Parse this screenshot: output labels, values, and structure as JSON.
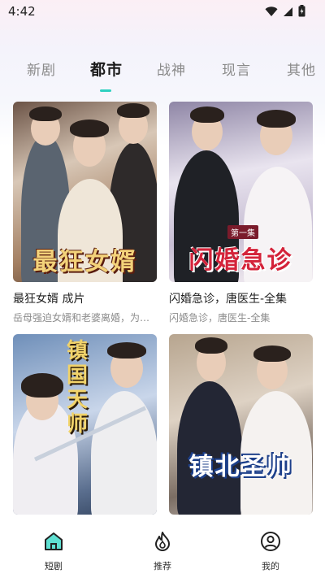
{
  "status_bar": {
    "time": "4:42"
  },
  "tabs": [
    {
      "label": "新剧",
      "active": false
    },
    {
      "label": "都市",
      "active": true
    },
    {
      "label": "战神",
      "active": false
    },
    {
      "label": "现言",
      "active": false
    },
    {
      "label": "其他",
      "active": false
    }
  ],
  "cards": [
    {
      "title": "最狂女婿 成片",
      "description": "岳母强迫女婿和老婆离婚，为了钱……",
      "poster_text": "最狂女婿"
    },
    {
      "title": "闪婚急诊，唐医生-全集",
      "description": "闪婚急诊，唐医生-全集",
      "poster_text": "闪婚急诊",
      "poster_badge": "第一集"
    },
    {
      "title": "",
      "description": "",
      "poster_text": "镇国天师"
    },
    {
      "title": "",
      "description": "",
      "poster_text": "镇北圣帅"
    }
  ],
  "bottom_nav": [
    {
      "label": "短剧",
      "icon": "home-icon",
      "active": true
    },
    {
      "label": "推荐",
      "icon": "flame-icon",
      "active": false
    },
    {
      "label": "我的",
      "icon": "profile-icon",
      "active": false
    }
  ],
  "colors": {
    "accent": "#2fd0c0"
  }
}
